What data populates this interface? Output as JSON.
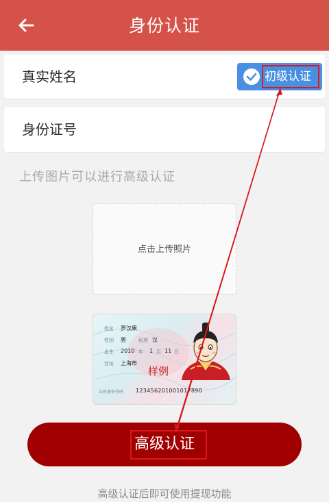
{
  "header": {
    "title": "身份认证"
  },
  "form": {
    "name_label": "真实姓名",
    "id_label": "身份证号",
    "badge_label": "初级认证"
  },
  "upload": {
    "hint": "上传图片可以进行高级认证",
    "placeholder": "点击上传照片"
  },
  "sample_card": {
    "name_label": "姓名",
    "name": "罗汉果",
    "gender_label": "性别",
    "gender": "男",
    "ethnicity_label": "民族",
    "ethnicity": "汉",
    "birth_label": "出生",
    "birth_year": "2010",
    "year_unit": "年",
    "birth_month": "1",
    "month_unit": "月",
    "birth_day": "11",
    "day_unit": "日",
    "address_label": "住址",
    "address": "上海市",
    "watermark": "样例",
    "id_number_label": "公民身份号码",
    "id_number": "123456201001017890"
  },
  "actions": {
    "submit_label": "高级认证"
  },
  "footer": {
    "tip": "高级认证后即可使用提现功能"
  },
  "colors": {
    "header": "#d55249",
    "button": "#a00000",
    "badge": "#4a90e2",
    "annotation": "#d9191c"
  },
  "icons": {
    "back": "arrow-left-icon",
    "badge": "check-circle-icon"
  }
}
